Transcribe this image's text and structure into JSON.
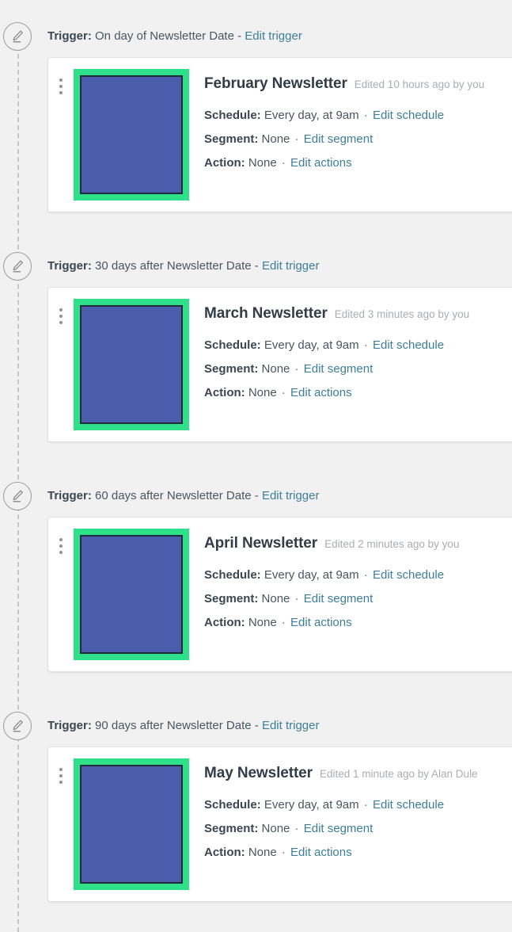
{
  "theme": {
    "page_bg": "#f1f1f1",
    "card_bg": "#ffffff",
    "link_color": "#3d7e98",
    "text_color": "#4a5560",
    "muted_color": "#a9adb2",
    "thumb_fill": "#4c5cad",
    "thumb_highlight": "#2ee089",
    "rail_color": "#c6c6c6"
  },
  "icons": {
    "pencil": "pencil-edit-icon",
    "kebab": "more-options-icon"
  },
  "labels": {
    "trigger_label": "Trigger:",
    "trigger_separator": "-",
    "schedule_label": "Schedule:",
    "segment_label": "Segment:",
    "action_label": "Action:",
    "meta_separator": "·",
    "edit_trigger": "Edit trigger",
    "edit_schedule": "Edit schedule",
    "edit_segment": "Edit segment",
    "edit_actions": "Edit actions"
  },
  "steps": [
    {
      "trigger_value": "On day of Newsletter Date",
      "title": "February Newsletter",
      "edited": "Edited 10 hours ago by you",
      "schedule_value": "Every day, at 9am",
      "segment_value": "None",
      "action_value": "None"
    },
    {
      "trigger_value": "30 days after Newsletter Date",
      "title": "March Newsletter",
      "edited": "Edited 3 minutes ago by you",
      "schedule_value": "Every day, at 9am",
      "segment_value": "None",
      "action_value": "None"
    },
    {
      "trigger_value": "60 days after Newsletter Date",
      "title": "April Newsletter",
      "edited": "Edited 2 minutes ago by you",
      "schedule_value": "Every day, at 9am",
      "segment_value": "None",
      "action_value": "None"
    },
    {
      "trigger_value": "90 days after Newsletter Date",
      "title": "May Newsletter",
      "edited": "Edited 1 minute ago by Alan Dule",
      "schedule_value": "Every day, at 9am",
      "segment_value": "None",
      "action_value": "None"
    }
  ]
}
